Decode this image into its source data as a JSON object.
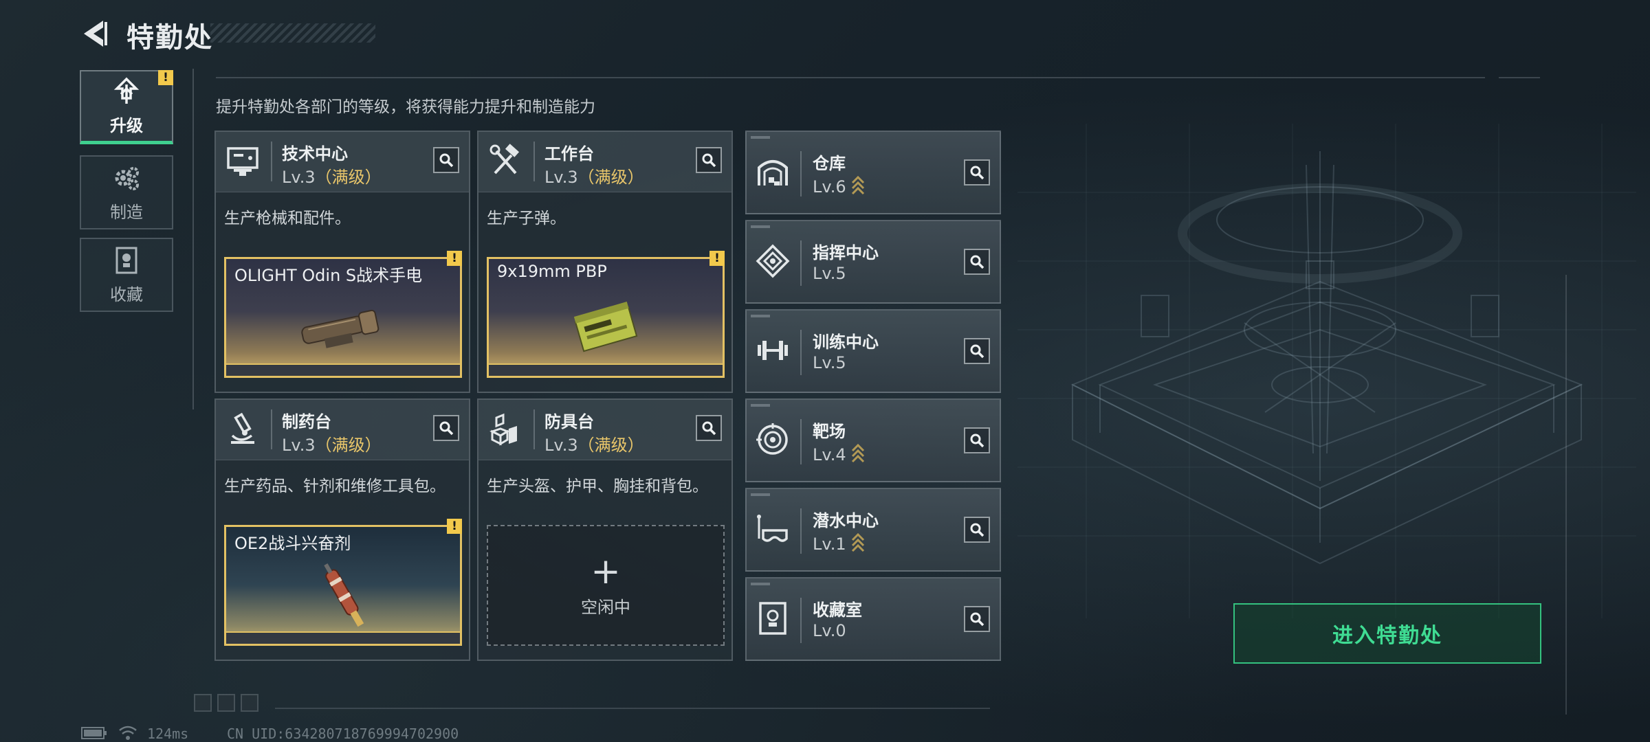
{
  "header": {
    "title": "特勤处"
  },
  "nav": {
    "tabs": [
      {
        "label": "升级",
        "icon": "upgrade-icon",
        "active": true,
        "alert": true
      },
      {
        "label": "制造",
        "icon": "gears-icon",
        "active": false
      },
      {
        "label": "收藏",
        "icon": "trophy-icon",
        "active": false
      }
    ]
  },
  "main": {
    "subtitle": "提升特勤处各部门的等级，将获得能力提升和制造能力",
    "cards": [
      {
        "name": "技术中心",
        "level": "Lv.3",
        "maxed": "（满级）",
        "desc": "生产枪械和配件。",
        "product": "OLIGHT Odin S战术手电",
        "icon": "monitor-icon"
      },
      {
        "name": "工作台",
        "level": "Lv.3",
        "maxed": "（满级）",
        "desc": "生产子弹。",
        "product": "9x19mm PBP",
        "icon": "hammer-wrench-icon"
      },
      {
        "name": "制药台",
        "level": "Lv.3",
        "maxed": "（满级）",
        "desc": "生产药品、针剂和维修工具包。",
        "product": "OE2战斗兴奋剂",
        "icon": "microscope-icon"
      },
      {
        "name": "防具台",
        "level": "Lv.3",
        "maxed": "（满级）",
        "desc": "生产头盔、护甲、胸挂和背包。",
        "idle": "空闲中",
        "icon": "armor-blocks-icon"
      }
    ],
    "alert_mark": "!"
  },
  "facilities": [
    {
      "name": "仓库",
      "level": "Lv.6",
      "upgradable": true,
      "icon": "warehouse-icon"
    },
    {
      "name": "指挥中心",
      "level": "Lv.5",
      "upgradable": false,
      "icon": "command-icon"
    },
    {
      "name": "训练中心",
      "level": "Lv.5",
      "upgradable": false,
      "icon": "dumbbell-icon"
    },
    {
      "name": "靶场",
      "level": "Lv.4",
      "upgradable": true,
      "icon": "target-icon"
    },
    {
      "name": "潜水中心",
      "level": "Lv.1",
      "upgradable": true,
      "icon": "dive-mask-icon"
    },
    {
      "name": "收藏室",
      "level": "Lv.0",
      "upgradable": false,
      "icon": "trophy-case-icon"
    }
  ],
  "enter_button": {
    "label": "进入特勤处"
  },
  "footer": {
    "ping": "124ms",
    "uid": "CN UID:634280718769994702900"
  },
  "colors": {
    "accent": "#3fdc93",
    "gold": "#e9c66a",
    "alert": "#f2c94c"
  }
}
